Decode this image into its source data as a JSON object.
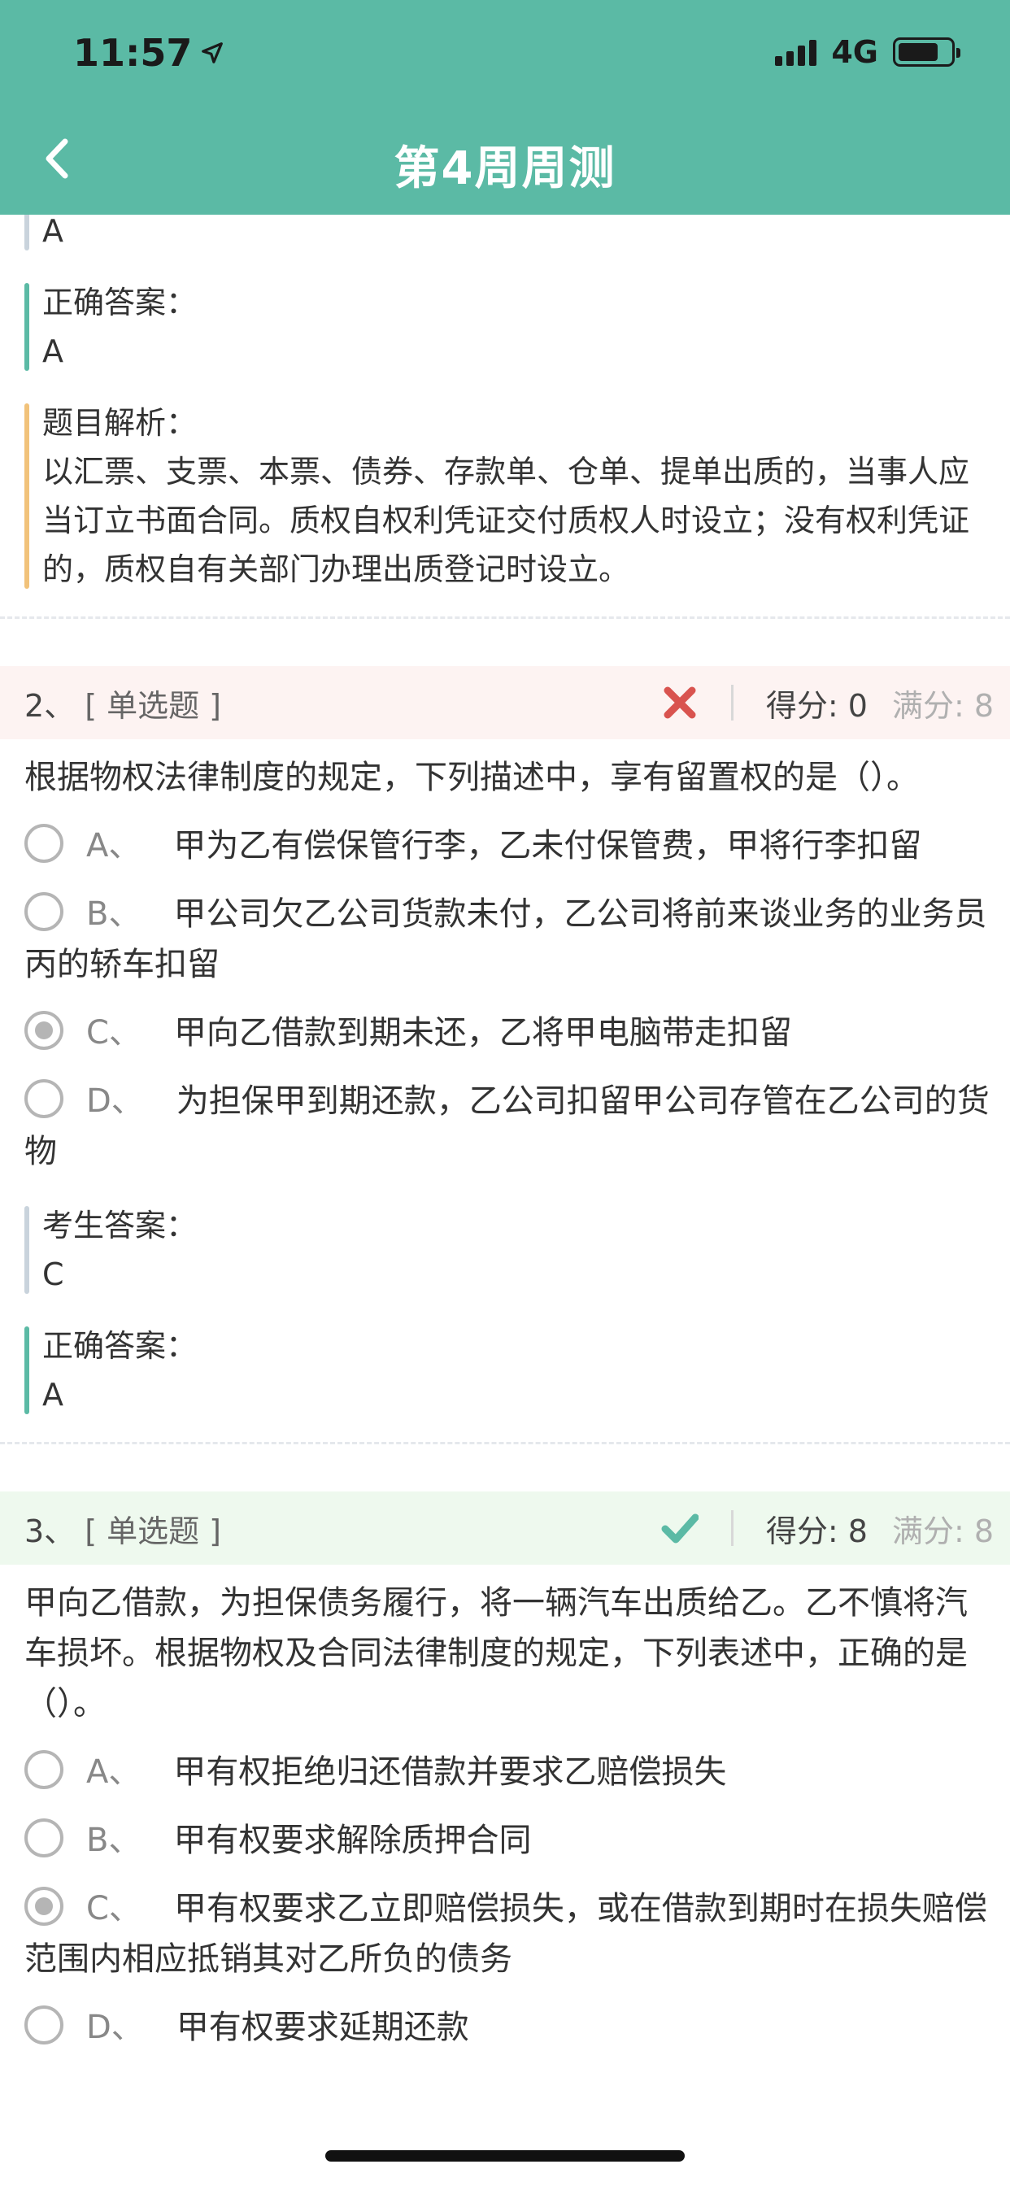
{
  "status_bar": {
    "time": "11:57",
    "network": "4G"
  },
  "header": {
    "title": "第4周周测"
  },
  "q1_tail": {
    "student_answer_value": "A",
    "correct_answer_label": "正确答案：",
    "correct_answer_value": "A",
    "analysis_label": "题目解析：",
    "analysis_text": "以汇票、支票、本票、债券、存款单、仓单、提单出质的，当事人应当订立书面合同。质权自权利凭证交付质权人时设立；没有权利凭证的，质权自有关部门办理出质登记时设立。"
  },
  "questions": [
    {
      "number": "2、",
      "type": "[ 单选题 ]",
      "result": "wrong",
      "score": "得分: 0",
      "full": "满分: 8",
      "stem": "根据物权法律制度的规定，下列描述中，享有留置权的是（）。",
      "options": [
        {
          "letter": "A、",
          "text": "甲为乙有偿保管行李，乙未付保管费，甲将行李扣留",
          "checked": false
        },
        {
          "letter": "B、",
          "text": "甲公司欠乙公司货款未付，乙公司将前来谈业务的业务员丙的轿车扣留",
          "checked": false
        },
        {
          "letter": "C、",
          "text": "甲向乙借款到期未还，乙将甲电脑带走扣留",
          "checked": true
        },
        {
          "letter": "D、",
          "text": "为担保甲到期还款，乙公司扣留甲公司存管在乙公司的货物",
          "checked": false
        }
      ],
      "student_answer_label": "考生答案：",
      "student_answer_value": "C",
      "correct_answer_label": "正确答案：",
      "correct_answer_value": "A"
    },
    {
      "number": "3、",
      "type": "[ 单选题 ]",
      "result": "right",
      "score": "得分: 8",
      "full": "满分: 8",
      "stem": "甲向乙借款，为担保债务履行，将一辆汽车出质给乙。乙不慎将汽车损坏。根据物权及合同法律制度的规定，下列表述中，正确的是（）。",
      "options": [
        {
          "letter": "A、",
          "text": "甲有权拒绝归还借款并要求乙赔偿损失",
          "checked": false
        },
        {
          "letter": "B、",
          "text": "甲有权要求解除质押合同",
          "checked": false
        },
        {
          "letter": "C、",
          "text": "甲有权要求乙立即赔偿损失，或在借款到期时在损失赔偿范围内相应抵销其对乙所负的债务",
          "checked": true
        },
        {
          "letter": "D、",
          "text": "甲有权要求延期还款",
          "checked": false
        }
      ]
    }
  ],
  "colors": {
    "header": "#5bbaa5",
    "wrong_mark": "#d9534f",
    "right_mark": "#5bbaa5"
  }
}
